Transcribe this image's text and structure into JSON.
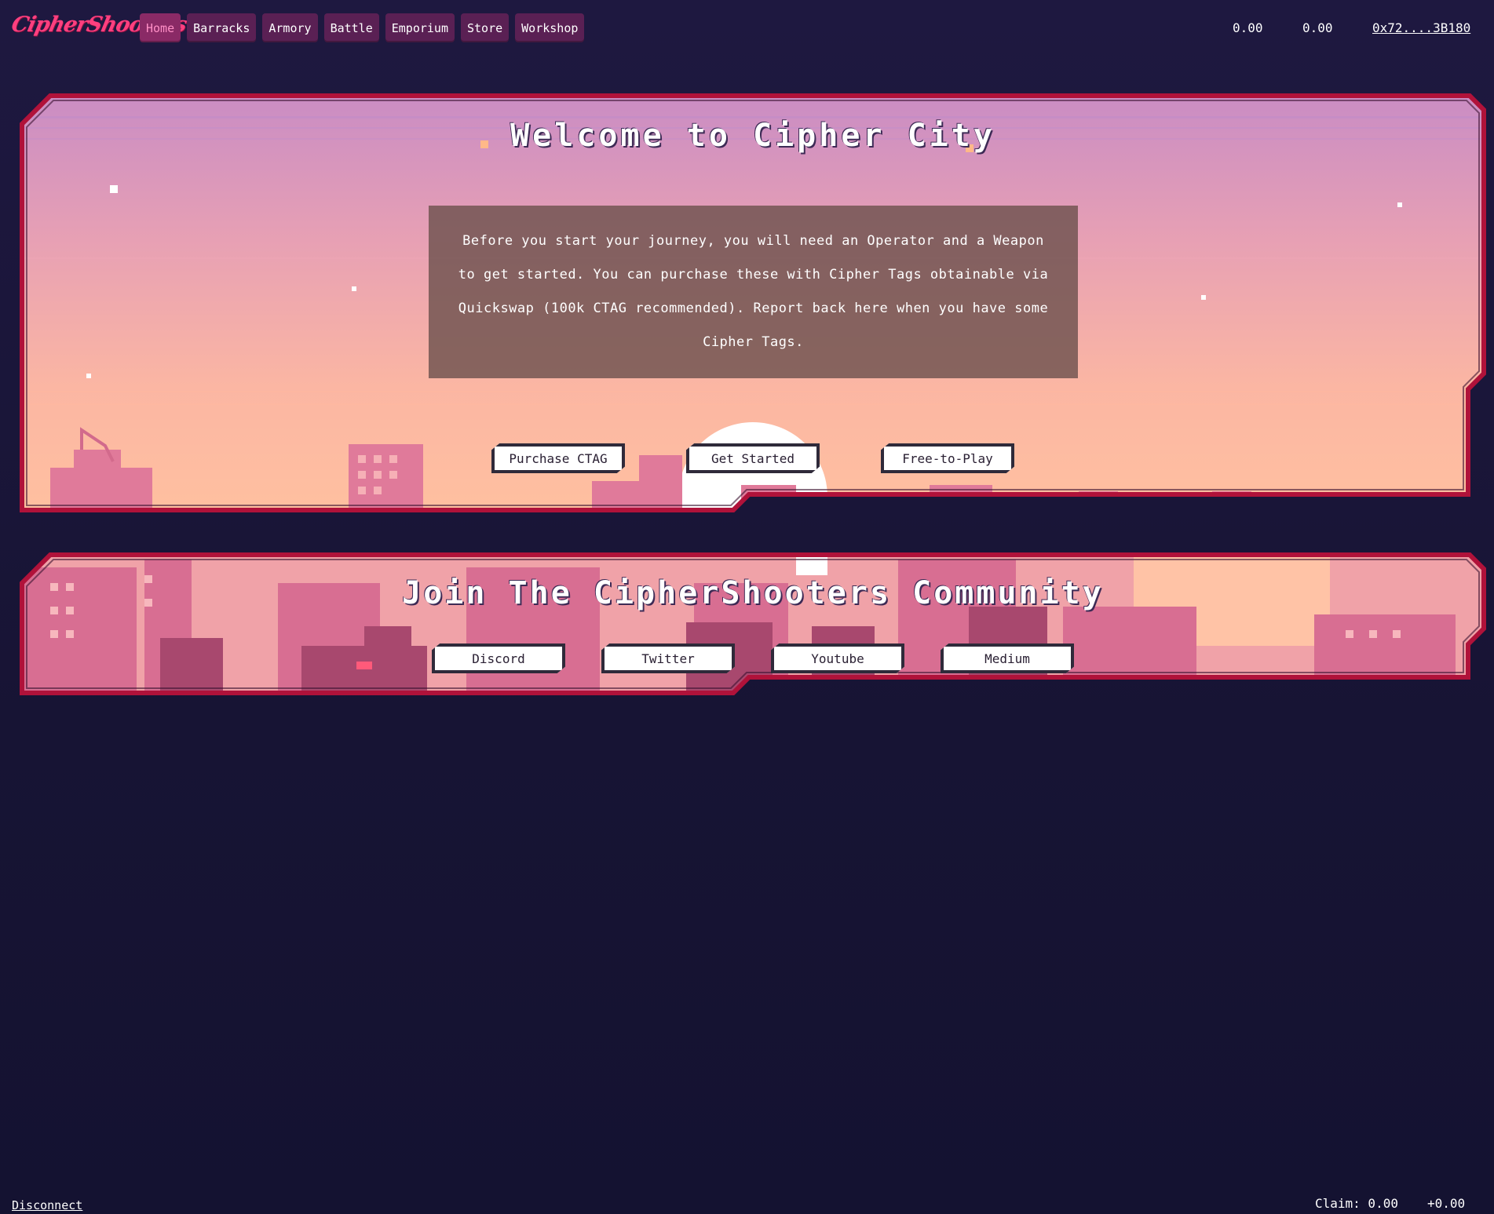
{
  "brand": {
    "logo_text": "CipherShooters"
  },
  "nav": {
    "items": [
      {
        "label": "Home",
        "active": true
      },
      {
        "label": "Barracks",
        "active": false
      },
      {
        "label": "Armory",
        "active": false
      },
      {
        "label": "Battle",
        "active": false
      },
      {
        "label": "Emporium",
        "active": false
      },
      {
        "label": "Store",
        "active": false
      },
      {
        "label": "Workshop",
        "active": false
      }
    ]
  },
  "header": {
    "balance_1": "0.00",
    "balance_2": "0.00",
    "wallet_address": "0x72....3B180"
  },
  "hero": {
    "title": "Welcome to Cipher City",
    "intro": "Before you start your journey, you will need an Operator and a Weapon to get started. You can purchase these with Cipher Tags obtainable via Quickswap (100k CTAG recommended). Report back here when you have some Cipher Tags.",
    "buttons": {
      "purchase": "Purchase CTAG",
      "get_started": "Get Started",
      "free_to_play": "Free-to-Play"
    }
  },
  "community": {
    "title": "Join The CipherShooters Community",
    "links": {
      "discord": "Discord",
      "twitter": "Twitter",
      "youtube": "Youtube",
      "medium": "Medium"
    }
  },
  "footer": {
    "disconnect": "Disconnect",
    "claim": "Claim: 0.00",
    "claim_delta": "+0.00"
  },
  "colors": {
    "background": "#171434",
    "accent": "#ff3f7f",
    "panel_border": "#b0123a",
    "nav_bg": "#5a2054",
    "nav_active_bg": "#8a2a66"
  }
}
